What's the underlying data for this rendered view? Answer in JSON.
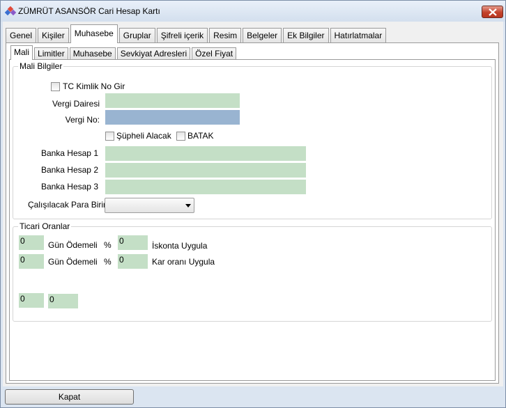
{
  "window": {
    "title": "ZÜMRÜT ASANSÖR Cari Hesap Kartı"
  },
  "main_tabs": [
    {
      "label": "Genel"
    },
    {
      "label": "Kişiler"
    },
    {
      "label": "Muhasebe"
    },
    {
      "label": "Gruplar"
    },
    {
      "label": "Şifreli içerik"
    },
    {
      "label": "Resim"
    },
    {
      "label": "Belgeler"
    },
    {
      "label": "Ek Bilgiler"
    },
    {
      "label": "Hatırlatmalar"
    }
  ],
  "sub_tabs": [
    {
      "label": "Mali"
    },
    {
      "label": "Limitler"
    },
    {
      "label": "Muhasebe"
    },
    {
      "label": "Sevkiyat Adresleri"
    },
    {
      "label": "Özel Fiyat"
    }
  ],
  "mali_bilgiler": {
    "legend": "Mali Bilgiler",
    "tc_checkbox": "TC Kimlik No Gir",
    "vergi_dairesi_label": "Vergi Dairesi",
    "vergi_no_label": "Vergi No:",
    "supheli_checkbox": "Şüpheli Alacak",
    "batak_checkbox": "BATAK",
    "banka1_label": "Banka Hesap 1",
    "banka2_label": "Banka Hesap 2",
    "banka3_label": "Banka Hesap 3",
    "para_birimi_label": "Çalışılacak Para Birimi",
    "para_birimi_value": ""
  },
  "ticari_oranlar": {
    "legend": "Ticari Oranlar",
    "row1": {
      "days": "0",
      "days_label": "Gün Ödemeli",
      "percent": "%",
      "rate": "0",
      "rate_label": "İskonta Uygula"
    },
    "row2": {
      "days": "0",
      "days_label": "Gün Ödemeli",
      "percent": "%",
      "rate": "0",
      "rate_label": "Kar oranı Uygula"
    },
    "extra1": "0",
    "extra2": "0"
  },
  "footer": {
    "close_button": "Kapat"
  },
  "colors": {
    "field_green": "#c4dfc6",
    "field_blue": "#99b4d1",
    "close_red": "#c3422b"
  }
}
